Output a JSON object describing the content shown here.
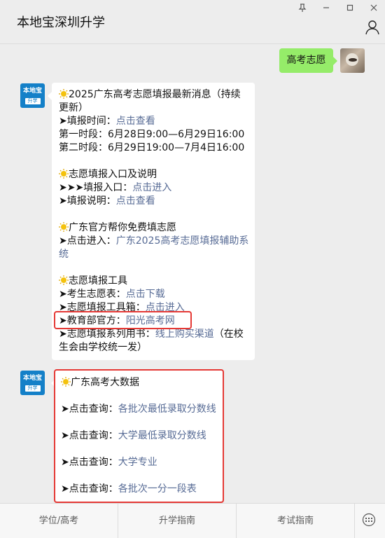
{
  "window": {
    "title": "本地宝深圳升学"
  },
  "chat": {
    "user_message": "高考志愿",
    "message1": {
      "section1_title": "2025广东高考志愿填报最新消息（持续",
      "section1_title_cont": "更新）",
      "line_time_label": "填报时间：",
      "line_time_link": "点击查看",
      "line_first": "第一时段：6月28日9:00—6月29日16:00",
      "line_second": "第二时段：6月29日19:00—7月4日16:00",
      "section2_title": "志愿填报入口及说明",
      "entry_label": "填报入口：",
      "entry_link": "点击进入",
      "desc_label": "填报说明：",
      "desc_link": "点击查看",
      "section3_title": "广东官方帮你免费填志愿",
      "official_label": "点击进入：",
      "official_link": "广东2025高考志愿填报辅助系",
      "official_link_cont": "统",
      "section4_title": "志愿填报工具",
      "tool1_label": "考生志愿表：",
      "tool1_link": "点击下载",
      "tool2_label": "志愿填报工具箱：",
      "tool2_link": "点击进入",
      "tool3_label": "教育部官方：",
      "tool3_link": "阳光高考网",
      "tool4_label": "志愿填报系列用书：",
      "tool4_link": "线上购买渠道",
      "tool4_rest": "（在校",
      "tool4_cont": "生会由学校统一发）"
    },
    "message2": {
      "title": "广东高考大数据",
      "query_label": "点击查询：",
      "q1": "各批次最低录取分数线",
      "q2": "大学最低录取分数线",
      "q3": "大学专业",
      "q4": "各批次一分一段表"
    },
    "bot_avatar_top": "本地宝",
    "bot_avatar_bottom": "升学"
  },
  "bottom_menu": {
    "tab1": "学位/高考",
    "tab2": "升学指南",
    "tab3": "考试指南"
  },
  "icons": [
    "pin-icon",
    "minimize-icon",
    "maximize-icon",
    "close-icon",
    "person-icon",
    "sun-icon",
    "arrow-icon",
    "keyboard-icon"
  ],
  "colors": {
    "link": "#576b95",
    "user_bubble": "#95ec69",
    "highlight_box": "#e53935",
    "bot_avatar": "#1480c8"
  }
}
